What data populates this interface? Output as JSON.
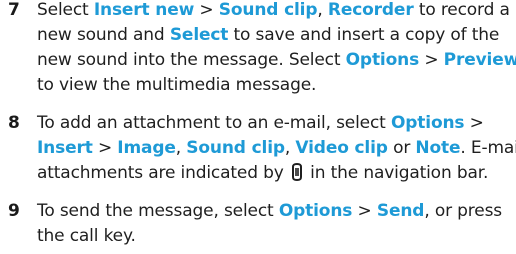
{
  "steps": [
    {
      "number": "7",
      "lines": [
        [
          "Select ",
          {
            "kw": "Insert new"
          },
          " > ",
          {
            "kw": "Sound clip"
          },
          ", ",
          {
            "kw": "Recorder"
          },
          " to record a"
        ],
        [
          "new sound and ",
          {
            "kw": "Select"
          },
          " to save and insert a copy of the"
        ],
        [
          "new sound into the message. Select ",
          {
            "kw": "Options"
          },
          " > ",
          {
            "kw": "Preview"
          }
        ],
        [
          "to view the multimedia message."
        ]
      ]
    },
    {
      "number": "8",
      "lines": [
        [
          "To add an attachment to an e-mail, select ",
          {
            "kw": "Options"
          },
          " >"
        ],
        [
          {
            "kw": "Insert"
          },
          " > ",
          {
            "kw": "Image"
          },
          ", ",
          {
            "kw": "Sound clip"
          },
          ", ",
          {
            "kw": "Video clip"
          },
          " or ",
          {
            "kw": "Note"
          },
          ". E-mail"
        ],
        [
          "attachments are indicated by ",
          {
            "icon": "paperclip-icon"
          },
          " in the navigation bar."
        ]
      ]
    },
    {
      "number": "9",
      "lines": [
        [
          "To send the message, select ",
          {
            "kw": "Options"
          },
          " > ",
          {
            "kw": "Send"
          },
          ", or press"
        ],
        [
          "the call key."
        ]
      ]
    }
  ],
  "colors": {
    "keyword": "#1e9ad6",
    "text": "#1f1f1f"
  }
}
